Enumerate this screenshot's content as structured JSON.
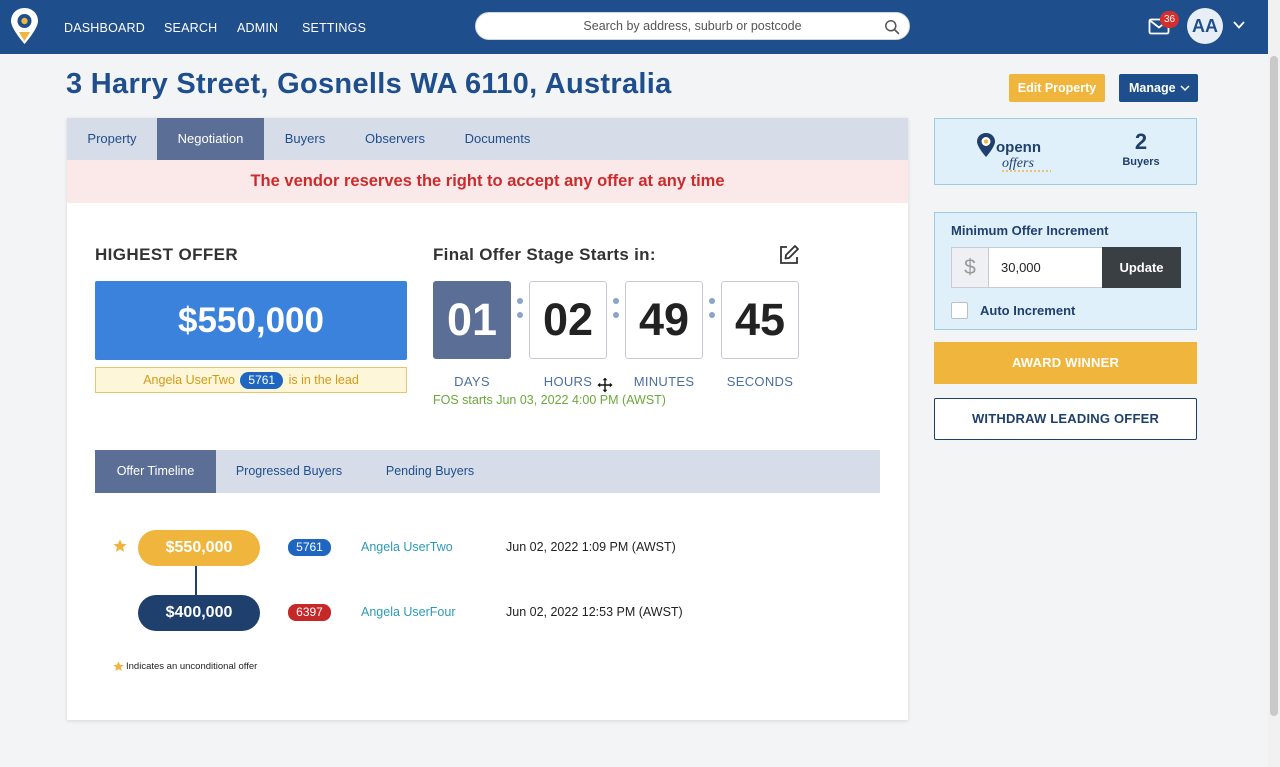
{
  "nav": {
    "items": [
      "DASHBOARD",
      "SEARCH",
      "ADMIN",
      "SETTINGS"
    ],
    "search_placeholder": "Search by address, suburb or postcode",
    "mail_count": "36",
    "avatar_initials": "AA"
  },
  "header": {
    "title": "3 Harry Street, Gosnells WA 6110, Australia",
    "edit_label": "Edit Property",
    "manage_label": "Manage"
  },
  "tabs": [
    {
      "label": "Property",
      "active": false
    },
    {
      "label": "Negotiation",
      "active": true
    },
    {
      "label": "Buyers",
      "active": false
    },
    {
      "label": "Observers",
      "active": false
    },
    {
      "label": "Documents",
      "active": false
    }
  ],
  "banner": "The vendor reserves the right to accept any offer at any time",
  "highest_offer": {
    "label": "HIGHEST OFFER",
    "amount": "$550,000",
    "leader_name": "Angela UserTwo",
    "leader_id": "5761",
    "lead_suffix": "is in the lead"
  },
  "final_offer_stage": {
    "label": "Final Offer Stage Starts in:",
    "days": "01",
    "hours": "02",
    "minutes": "49",
    "seconds": "45",
    "units": {
      "days": "DAYS",
      "hours": "HOURS",
      "minutes": "MINUTES",
      "seconds": "SECONDS"
    },
    "starts_text": "FOS starts Jun 03, 2022 4:00 PM (AWST)"
  },
  "sub_tabs": [
    {
      "label": "Offer Timeline",
      "active": true
    },
    {
      "label": "Progressed Buyers",
      "active": false
    },
    {
      "label": "Pending Buyers",
      "active": false
    }
  ],
  "timeline": [
    {
      "amount": "$550,000",
      "id": "5761",
      "buyer": "Angela UserTwo",
      "date": "Jun 02, 2022 1:09 PM (AWST)",
      "unconditional": true
    },
    {
      "amount": "$400,000",
      "id": "6397",
      "buyer": "Angela UserFour",
      "date": "Jun 02, 2022 12:53 PM (AWST)",
      "unconditional": false
    }
  ],
  "legend": "Indicates an unconditional offer",
  "openn": {
    "buyers_count": "2",
    "buyers_label": "Buyers",
    "logo_text_top": "openn",
    "logo_text_bottom": "offers"
  },
  "increment": {
    "label": "Minimum Offer Increment",
    "currency": "$",
    "value": "30,000",
    "update_label": "Update",
    "auto_label": "Auto Increment"
  },
  "actions": {
    "award_label": "AWARD WINNER",
    "withdraw_label": "WITHDRAW LEADING OFFER"
  },
  "colors": {
    "brand_navy": "#1f4e8c",
    "gold": "#f0b53d",
    "offer_blue": "#3b82dc",
    "alert_red": "#cc2b2b"
  }
}
